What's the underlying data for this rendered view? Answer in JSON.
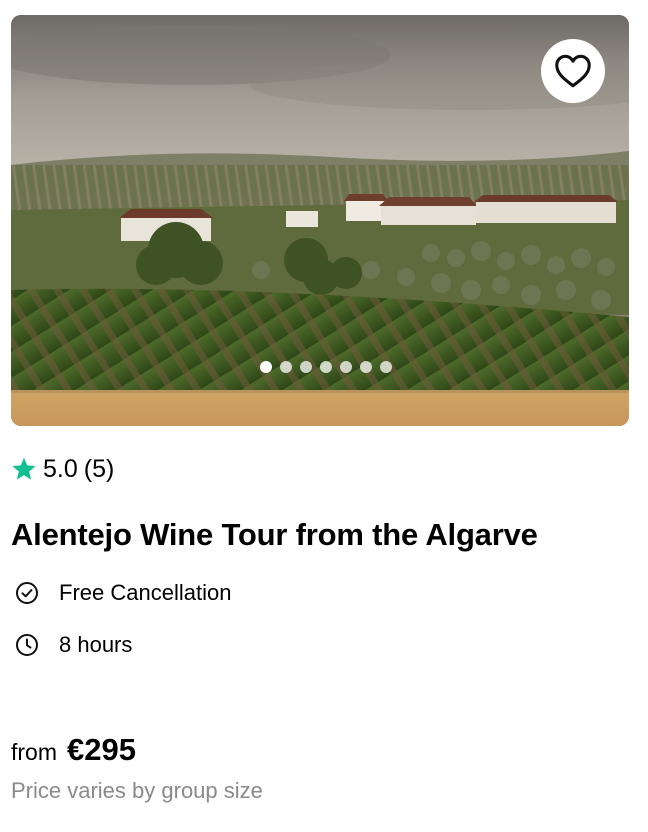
{
  "card": {
    "image_alt": "Vineyard landscape with white farm buildings",
    "favorite_icon": "heart-icon",
    "carousel": {
      "total": 7,
      "active": 1
    },
    "rating": {
      "icon": "star-icon",
      "star_color": "#14c08f",
      "score": "5.0",
      "count": "(5)"
    },
    "title": "Alentejo Wine Tour from the Algarve",
    "features": [
      {
        "icon": "check-circle-icon",
        "label": "Free Cancellation"
      },
      {
        "icon": "clock-icon",
        "label": "8 hours"
      }
    ],
    "price": {
      "from_label": "from",
      "amount": "€295",
      "note": "Price varies by group size"
    }
  }
}
